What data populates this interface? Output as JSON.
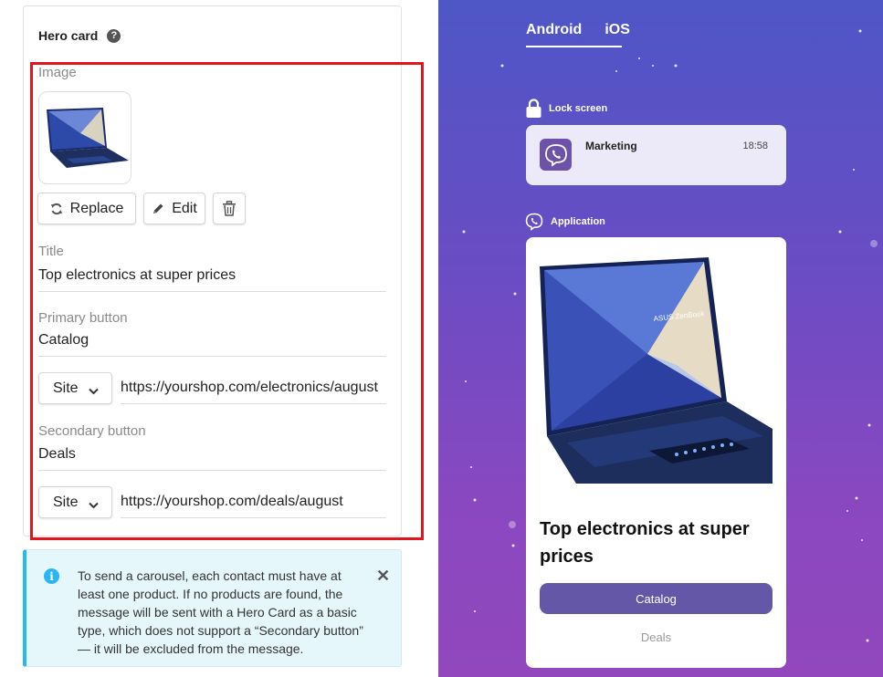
{
  "editor": {
    "card_title": "Hero card",
    "image_label": "Image",
    "buttons": {
      "replace": "Replace",
      "edit": "Edit"
    },
    "title_label": "Title",
    "title_value": "Top electronics at super prices",
    "primary_label": "Primary button",
    "primary_value": "Catalog",
    "primary_link_type": "Site",
    "primary_url": "https://yourshop.com/electronics/august",
    "secondary_label": "Secondary button",
    "secondary_value": "Deals",
    "secondary_link_type": "Site",
    "secondary_url": "https://yourshop.com/deals/august"
  },
  "info_banner": {
    "text": "To send a carousel, each contact must have at least one product. If no products are found, the message will be sent with a Hero Card as a basic type, which does not support a “Secondary button” — it will be excluded from the message."
  },
  "preview": {
    "tabs": [
      "Android",
      "iOS"
    ],
    "lock_screen_label": "Lock screen",
    "notification": {
      "title": "Marketing",
      "time": "18:58"
    },
    "application_label": "Application",
    "card": {
      "title": "Top electronics at super prices",
      "primary_button": "Catalog",
      "secondary_button": "Deals",
      "image_brand_text": "ASUS ZenBook"
    }
  },
  "colors": {
    "highlight_border": "#e3141b",
    "info_accent": "#29b6f6",
    "preview_gradient_top": "#4e56c6",
    "preview_gradient_bottom": "#9247bd",
    "primary_button": "#6557a8"
  },
  "icons": [
    "help-icon",
    "refresh-icon",
    "pencil-icon",
    "trash-icon",
    "chevron-down-icon",
    "info-icon",
    "close-icon",
    "lock-icon",
    "viber-icon"
  ]
}
